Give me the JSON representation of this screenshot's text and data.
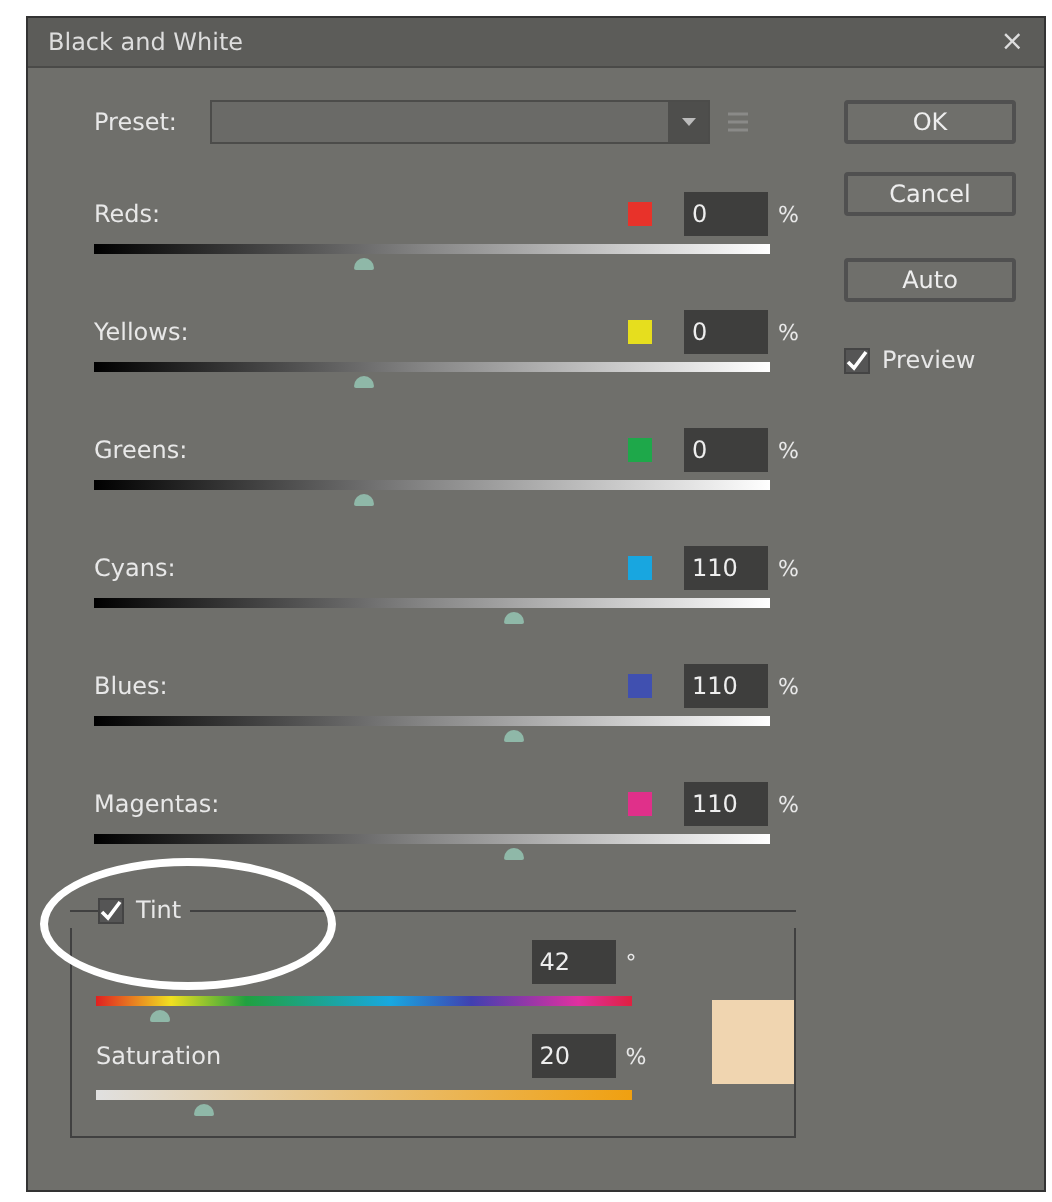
{
  "window": {
    "title": "Black and White",
    "close": "×"
  },
  "preset": {
    "label": "Preset:"
  },
  "channels": [
    {
      "name": "Reds:",
      "color": "#e8322a",
      "value": "0",
      "unit": "%",
      "level": 0.4
    },
    {
      "name": "Yellows:",
      "color": "#e6de1e",
      "value": "0",
      "unit": "%",
      "level": 0.4
    },
    {
      "name": "Greens:",
      "color": "#1ea84a",
      "value": "0",
      "unit": "%",
      "level": 0.4
    },
    {
      "name": "Cyans:",
      "color": "#18a6e0",
      "value": "110",
      "unit": "%",
      "level": 0.62
    },
    {
      "name": "Blues:",
      "color": "#4050b0",
      "value": "110",
      "unit": "%",
      "level": 0.62
    },
    {
      "name": "Magentas:",
      "color": "#e0308a",
      "value": "110",
      "unit": "%",
      "level": 0.62
    }
  ],
  "tint": {
    "label": "Tint",
    "checked": true,
    "color": "#f0d5b0",
    "hue": {
      "value": "42",
      "unit": "°",
      "level": 0.12
    },
    "saturation": {
      "label": "Saturation",
      "value": "20",
      "unit": "%",
      "level": 0.2
    }
  },
  "buttons": [
    "OK",
    "Cancel",
    "Auto"
  ],
  "preview": {
    "label": "Preview",
    "checked": true
  }
}
